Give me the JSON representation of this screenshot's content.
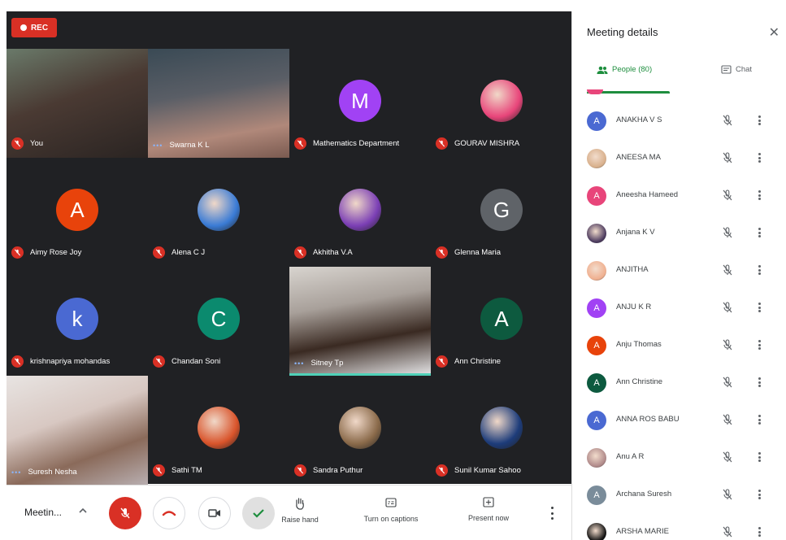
{
  "recording": {
    "label": "REC"
  },
  "tiles": [
    {
      "name": "You",
      "kind": "video",
      "muted": true
    },
    {
      "name": "Swarna K L",
      "kind": "video",
      "muted": false
    },
    {
      "name": "Mathematics Department",
      "kind": "letter",
      "initial": "M",
      "color": "#a142f4",
      "muted": true
    },
    {
      "name": "GOURAV MISHRA",
      "kind": "photo",
      "color": "#e8457a",
      "muted": true
    },
    {
      "name": "Aimy Rose Joy",
      "kind": "letter",
      "initial": "A",
      "color": "#e8430b",
      "muted": true
    },
    {
      "name": "Alena C J",
      "kind": "photo",
      "color": "#3a7bd5",
      "muted": true
    },
    {
      "name": "Akhitha V.A",
      "kind": "photo",
      "color": "#7b3fb5",
      "muted": true
    },
    {
      "name": "Glenna Maria",
      "kind": "letter",
      "initial": "G",
      "color": "#5f6368",
      "muted": true
    },
    {
      "name": "krishnapriya mohandas",
      "kind": "letter",
      "initial": "k",
      "color": "#4a69d2",
      "muted": true
    },
    {
      "name": "Chandan Soni",
      "kind": "letter",
      "initial": "C",
      "color": "#0b8a6e",
      "muted": true
    },
    {
      "name": "Sitney Tp",
      "kind": "video",
      "muted": false
    },
    {
      "name": "Ann Christine",
      "kind": "letter",
      "initial": "A",
      "color": "#0d5a3f",
      "muted": true
    },
    {
      "name": "Suresh Nesha",
      "kind": "video",
      "muted": false
    },
    {
      "name": "Sathi TM",
      "kind": "photo",
      "color": "#d9542b",
      "muted": true
    },
    {
      "name": "Sandra Puthur",
      "kind": "photo",
      "color": "#8a6a4a",
      "muted": true
    },
    {
      "name": "Sunil Kumar Sahoo",
      "kind": "photo",
      "color": "#1d3c7a",
      "muted": true
    }
  ],
  "bottom_bar": {
    "meeting_label": "Meetin...",
    "raise_hand": "Raise hand",
    "captions": "Turn on captions",
    "present": "Present now"
  },
  "panel": {
    "title": "Meeting details",
    "tab_people": "People (80)",
    "tab_chat": "Chat",
    "accent": "#1e8e3e",
    "people": [
      {
        "name": "ANAKHA V S",
        "initial": "A",
        "color": "#4a69d2"
      },
      {
        "name": "ANEESA MA",
        "initial": "",
        "color": "#d8b08c"
      },
      {
        "name": "Aneesha Hameed",
        "initial": "A",
        "color": "#e8457a"
      },
      {
        "name": "Anjana K V",
        "initial": "",
        "color": "#4b3a5e"
      },
      {
        "name": "ANJITHA",
        "initial": "",
        "color": "#f0b090"
      },
      {
        "name": "ANJU K R",
        "initial": "A",
        "color": "#a142f4"
      },
      {
        "name": "Anju Thomas",
        "initial": "A",
        "color": "#e8430b"
      },
      {
        "name": "Ann Christine",
        "initial": "A",
        "color": "#0d5a3f"
      },
      {
        "name": "ANNA ROS BABU",
        "initial": "A",
        "color": "#4a69d2"
      },
      {
        "name": "Anu A R",
        "initial": "",
        "color": "#b08a8a"
      },
      {
        "name": "Archana Suresh",
        "initial": "A",
        "color": "#7a8c9a"
      },
      {
        "name": "ARSHA MARIE",
        "initial": "",
        "color": "#111111"
      }
    ]
  }
}
